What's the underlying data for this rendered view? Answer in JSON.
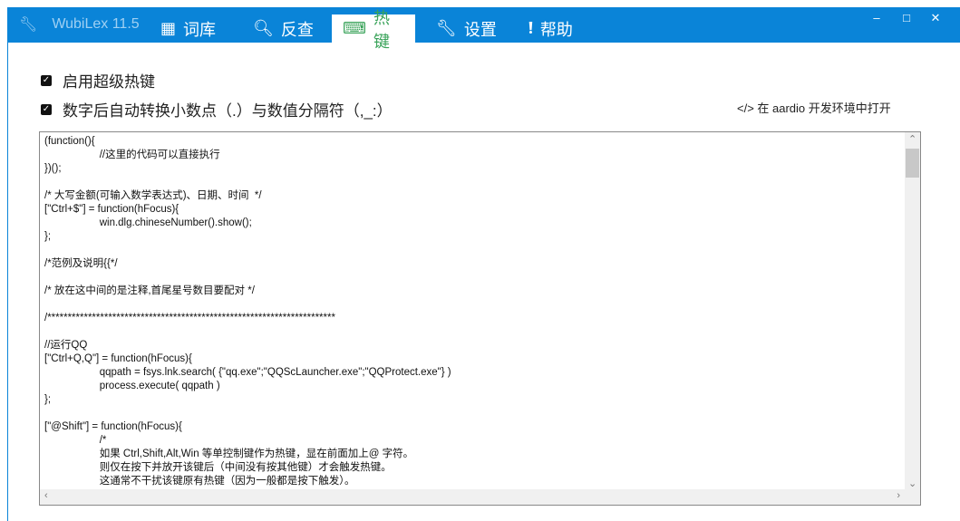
{
  "app": {
    "title": "WubiLex 11.5"
  },
  "tabs": [
    {
      "label": "词库",
      "icon": "grid-icon"
    },
    {
      "label": "反查",
      "icon": "search-icon"
    },
    {
      "label": "热键",
      "icon": "keyboard-icon"
    },
    {
      "label": "设置",
      "icon": "wrench-icon"
    },
    {
      "label": "帮助",
      "icon": "info-icon"
    }
  ],
  "window_controls": {
    "minimize": "–",
    "maximize": "□",
    "close": "✕"
  },
  "options": [
    {
      "label": "启用超级热键",
      "checked": true
    },
    {
      "label": "数字后自动转换小数点（.）与数值分隔符（,_:）",
      "checked": true
    }
  ],
  "open_link": "</> 在 aardio 开发环境中打开",
  "code_lines": [
    "(function(){",
    "\t//这里的代码可以直接执行",
    "})();",
    "",
    "/* 大写金额(可输入数学表达式)、日期、时间  */",
    "[\"Ctrl+$\"] = function(hFocus){",
    "\twin.dlg.chineseNumber().show();",
    "};",
    "",
    "/*范例及说明{{*/",
    "",
    "/* 放在这中间的是注释,首尾星号数目要配对 */",
    "",
    "/***********************************************************************",
    "",
    "//运行QQ",
    "[\"Ctrl+Q,Q\"] = function(hFocus){",
    "\tqqpath = fsys.lnk.search( {\"qq.exe\";\"QQScLauncher.exe\";\"QQProtect.exe\"} )",
    "\tprocess.execute( qqpath )",
    "};",
    "",
    "[\"@Shift\"] = function(hFocus){",
    "\t/*",
    "\t如果 Ctrl,Shift,Alt,Win 等单控制键作为热键，显在前面加上@ 字符。",
    "\t则仅在按下并放开该键后（中间没有按其他键）才会触发热键。",
    "\t这通常不干扰该键原有热键（因为一般都是按下触发）。"
  ],
  "colors": {
    "accent": "#0a84d8",
    "active_tab": "#3aa35a"
  }
}
